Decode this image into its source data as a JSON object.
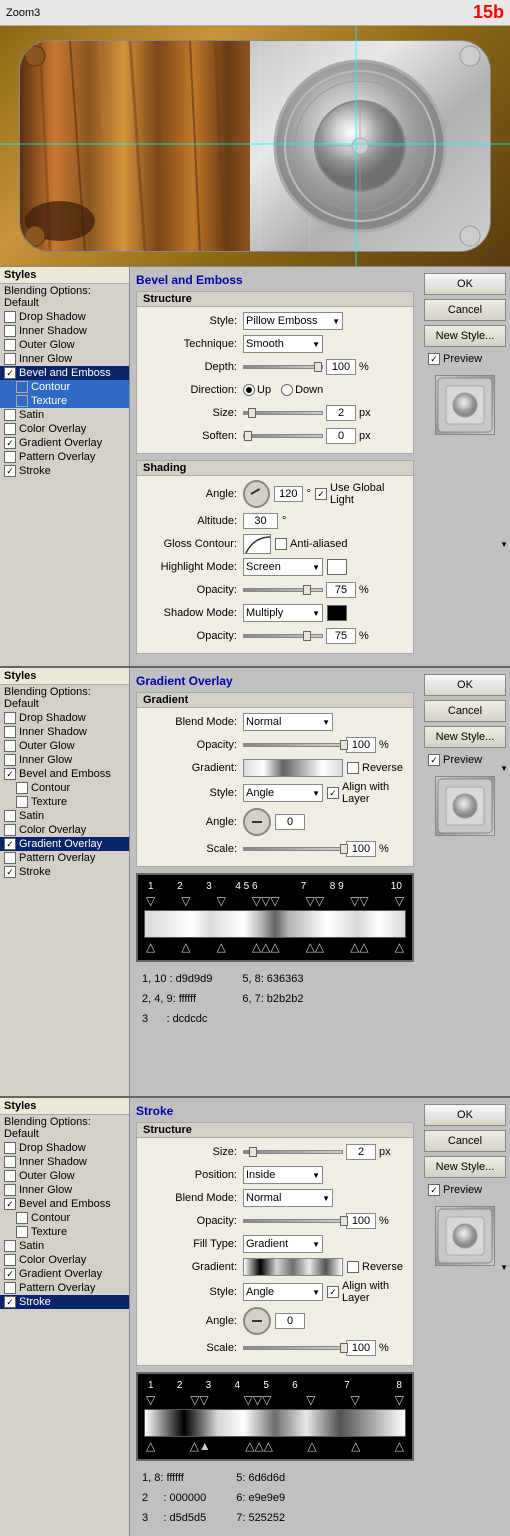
{
  "header": {
    "title": "Zoom3",
    "badge": "15b"
  },
  "panels": [
    {
      "id": "bevel-emboss",
      "header": "Bevel and Emboss",
      "styles_title": "Styles",
      "blending_options": "Blending Options: Default",
      "items": [
        {
          "label": "Drop Shadow",
          "checked": false,
          "selected": false
        },
        {
          "label": "Inner Shadow",
          "checked": false,
          "selected": false
        },
        {
          "label": "Outer Glow",
          "checked": false,
          "selected": false
        },
        {
          "label": "Inner Glow",
          "checked": false,
          "selected": false
        },
        {
          "label": "Bevel and Emboss",
          "checked": true,
          "selected": true
        },
        {
          "label": "Contour",
          "checked": false,
          "selected": false,
          "sub": true,
          "sub_selected": true
        },
        {
          "label": "Texture",
          "checked": false,
          "selected": false,
          "sub": true,
          "sub_selected": true
        },
        {
          "label": "Satin",
          "checked": false,
          "selected": false
        },
        {
          "label": "Color Overlay",
          "checked": false,
          "selected": false
        },
        {
          "label": "Gradient Overlay",
          "checked": true,
          "selected": false
        },
        {
          "label": "Pattern Overlay",
          "checked": false,
          "selected": false
        },
        {
          "label": "Stroke",
          "checked": true,
          "selected": false
        }
      ],
      "sections": {
        "structure": {
          "title": "Structure",
          "style": {
            "label": "Style:",
            "value": "Pillow Emboss"
          },
          "technique": {
            "label": "Technique:",
            "value": "Smooth"
          },
          "depth": {
            "label": "Depth:",
            "value": "100",
            "unit": "%"
          },
          "direction": {
            "label": "Direction:",
            "up": "Up",
            "down": "Down"
          },
          "size": {
            "label": "Size:",
            "value": "2",
            "unit": "px"
          },
          "soften": {
            "label": "Soften:",
            "value": "0",
            "unit": "px"
          }
        },
        "shading": {
          "title": "Shading",
          "angle": {
            "label": "Angle:",
            "value": "120",
            "unit": "°"
          },
          "use_global_light": "Use Global Light",
          "altitude": {
            "label": "Altitude:",
            "value": "30",
            "unit": "°"
          },
          "gloss_contour": {
            "label": "Gloss Contour:"
          },
          "anti_aliased": "Anti-aliased",
          "highlight_mode": {
            "label": "Highlight Mode:",
            "value": "Screen"
          },
          "highlight_opacity": {
            "label": "Opacity:",
            "value": "75",
            "unit": "%"
          },
          "shadow_mode": {
            "label": "Shadow Mode:",
            "value": "Multiply"
          },
          "shadow_opacity": {
            "label": "Opacity:",
            "value": "75",
            "unit": "%"
          }
        }
      },
      "buttons": {
        "ok": "OK",
        "cancel": "Cancel",
        "new_style": "New Style...",
        "preview": "Preview"
      }
    },
    {
      "id": "gradient-overlay",
      "header": "Gradient Overlay",
      "styles_title": "Styles",
      "blending_options": "Blending Options: Default",
      "items": [
        {
          "label": "Drop Shadow",
          "checked": false,
          "selected": false
        },
        {
          "label": "Inner Shadow",
          "checked": false,
          "selected": false
        },
        {
          "label": "Outer Glow",
          "checked": false,
          "selected": false
        },
        {
          "label": "Inner Glow",
          "checked": false,
          "selected": false
        },
        {
          "label": "Bevel and Emboss",
          "checked": true,
          "selected": false
        },
        {
          "label": "Contour",
          "checked": false,
          "selected": false,
          "sub": true
        },
        {
          "label": "Texture",
          "checked": false,
          "selected": false,
          "sub": true
        },
        {
          "label": "Satin",
          "checked": false,
          "selected": false
        },
        {
          "label": "Color Overlay",
          "checked": false,
          "selected": false
        },
        {
          "label": "Gradient Overlay",
          "checked": true,
          "selected": true
        },
        {
          "label": "Pattern Overlay",
          "checked": false,
          "selected": false
        },
        {
          "label": "Stroke",
          "checked": true,
          "selected": false
        }
      ],
      "section": {
        "title": "Gradient",
        "blend_mode": {
          "label": "Blend Mode:",
          "value": "Normal"
        },
        "opacity": {
          "label": "Opacity:",
          "value": "100",
          "unit": "%"
        },
        "gradient": {
          "label": "Gradient:",
          "reverse": "Reverse"
        },
        "style": {
          "label": "Style:",
          "value": "Angle",
          "align_with_layer": "Align with Layer"
        },
        "angle": {
          "label": "Angle:",
          "value": "0"
        },
        "scale": {
          "label": "Scale:",
          "value": "100",
          "unit": "%"
        }
      },
      "gradient_data": {
        "stops": "1  2  3     4 5 6     7  8  9     10",
        "info_line1": "1, 10 : d9d9d9",
        "info_line2": "2, 4, 9: ffffff",
        "info_line3": "3      : dcdcdc",
        "info_line4": "5, 8: 636363",
        "info_line5": "6, 7: b2b2b2"
      },
      "buttons": {
        "ok": "OK",
        "cancel": "Cancel",
        "new_style": "New Style...",
        "preview": "Preview"
      }
    },
    {
      "id": "stroke",
      "header": "Stroke",
      "styles_title": "Styles",
      "blending_options": "Blending Options: Default",
      "items": [
        {
          "label": "Drop Shadow",
          "checked": false,
          "selected": false
        },
        {
          "label": "Inner Shadow",
          "checked": false,
          "selected": false
        },
        {
          "label": "Outer Glow",
          "checked": false,
          "selected": false
        },
        {
          "label": "Inner Glow",
          "checked": false,
          "selected": false
        },
        {
          "label": "Bevel and Emboss",
          "checked": true,
          "selected": false
        },
        {
          "label": "Contour",
          "checked": false,
          "selected": false,
          "sub": true
        },
        {
          "label": "Texture",
          "checked": false,
          "selected": false,
          "sub": true
        },
        {
          "label": "Satin",
          "checked": false,
          "selected": false
        },
        {
          "label": "Color Overlay",
          "checked": false,
          "selected": false
        },
        {
          "label": "Gradient Overlay",
          "checked": true,
          "selected": false
        },
        {
          "label": "Pattern Overlay",
          "checked": false,
          "selected": false
        },
        {
          "label": "Stroke",
          "checked": true,
          "selected": true
        }
      ],
      "section": {
        "title": "Structure",
        "size": {
          "label": "Size:",
          "value": "2",
          "unit": "px"
        },
        "position": {
          "label": "Position:",
          "value": "Inside"
        },
        "blend_mode": {
          "label": "Blend Mode:",
          "value": "Normal"
        },
        "opacity": {
          "label": "Opacity:",
          "value": "100",
          "unit": "%"
        },
        "fill_type": {
          "label": "Fill Type:",
          "value": "Gradient"
        },
        "gradient": {
          "label": "Gradient:",
          "reverse": "Reverse"
        },
        "style": {
          "label": "Style:",
          "value": "Angle",
          "align_with_layer": "Align with Layer"
        },
        "angle": {
          "label": "Angle:",
          "value": "0"
        },
        "scale": {
          "label": "Scale:",
          "value": "100",
          "unit": "%"
        }
      },
      "gradient_data": {
        "stops": "1  2  3    4  5  6         7       8",
        "info_line1": "1, 8: ffffff",
        "info_line2": "2    : 000000",
        "info_line3": "3    : d5d5d5",
        "info_line4": "5: 6d6d6d",
        "info_line5": "6: e9e9e9",
        "info_line6": "7: 525252"
      },
      "buttons": {
        "ok": "OK",
        "cancel": "Cancel",
        "new_style": "New Style...",
        "preview": "Preview"
      }
    }
  ]
}
